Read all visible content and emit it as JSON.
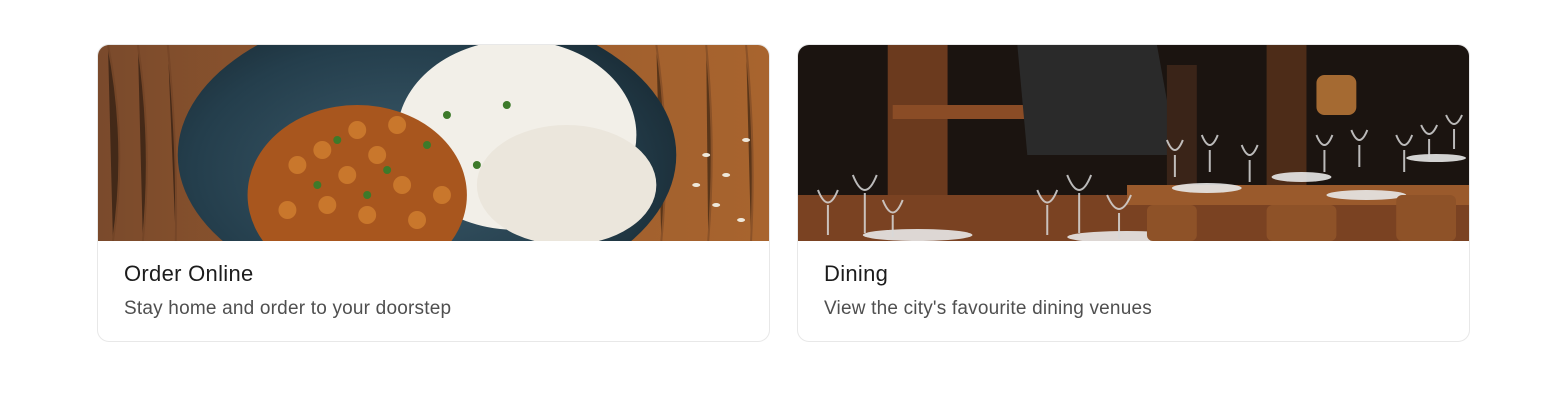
{
  "cards": [
    {
      "title": "Order Online",
      "subtitle": "Stay home and order to your doorstep",
      "image": "food-plate-rice-chickpea-curry"
    },
    {
      "title": "Dining",
      "subtitle": "View the city's favourite dining venues",
      "image": "restaurant-interior-tables-wine-glasses"
    }
  ]
}
